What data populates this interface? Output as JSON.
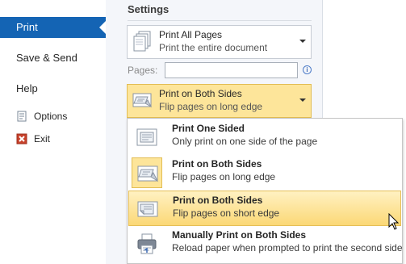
{
  "nav": {
    "active": "Print",
    "save_send": "Save & Send",
    "help": "Help",
    "options": "Options",
    "exit": "Exit"
  },
  "settings": {
    "title": "Settings",
    "print_what": {
      "label": "Print All Pages",
      "desc": "Print the entire document"
    },
    "pages_label": "Pages:",
    "pages_value": "",
    "sides": {
      "label": "Print on Both Sides",
      "desc": "Flip pages on long edge"
    }
  },
  "menu": {
    "items": [
      {
        "label": "Print One Sided",
        "desc": "Only print on one side of the page"
      },
      {
        "label": "Print on Both Sides",
        "desc": "Flip pages on long edge"
      },
      {
        "label": "Print on Both Sides",
        "desc": "Flip pages on short edge"
      },
      {
        "label": "Manually Print on Both Sides",
        "desc": "Reload paper when prompted to print the second side"
      }
    ]
  },
  "colors": {
    "accent": "#1464b4",
    "highlight": "#fde59a",
    "highlight_border": "#e2bd53"
  }
}
